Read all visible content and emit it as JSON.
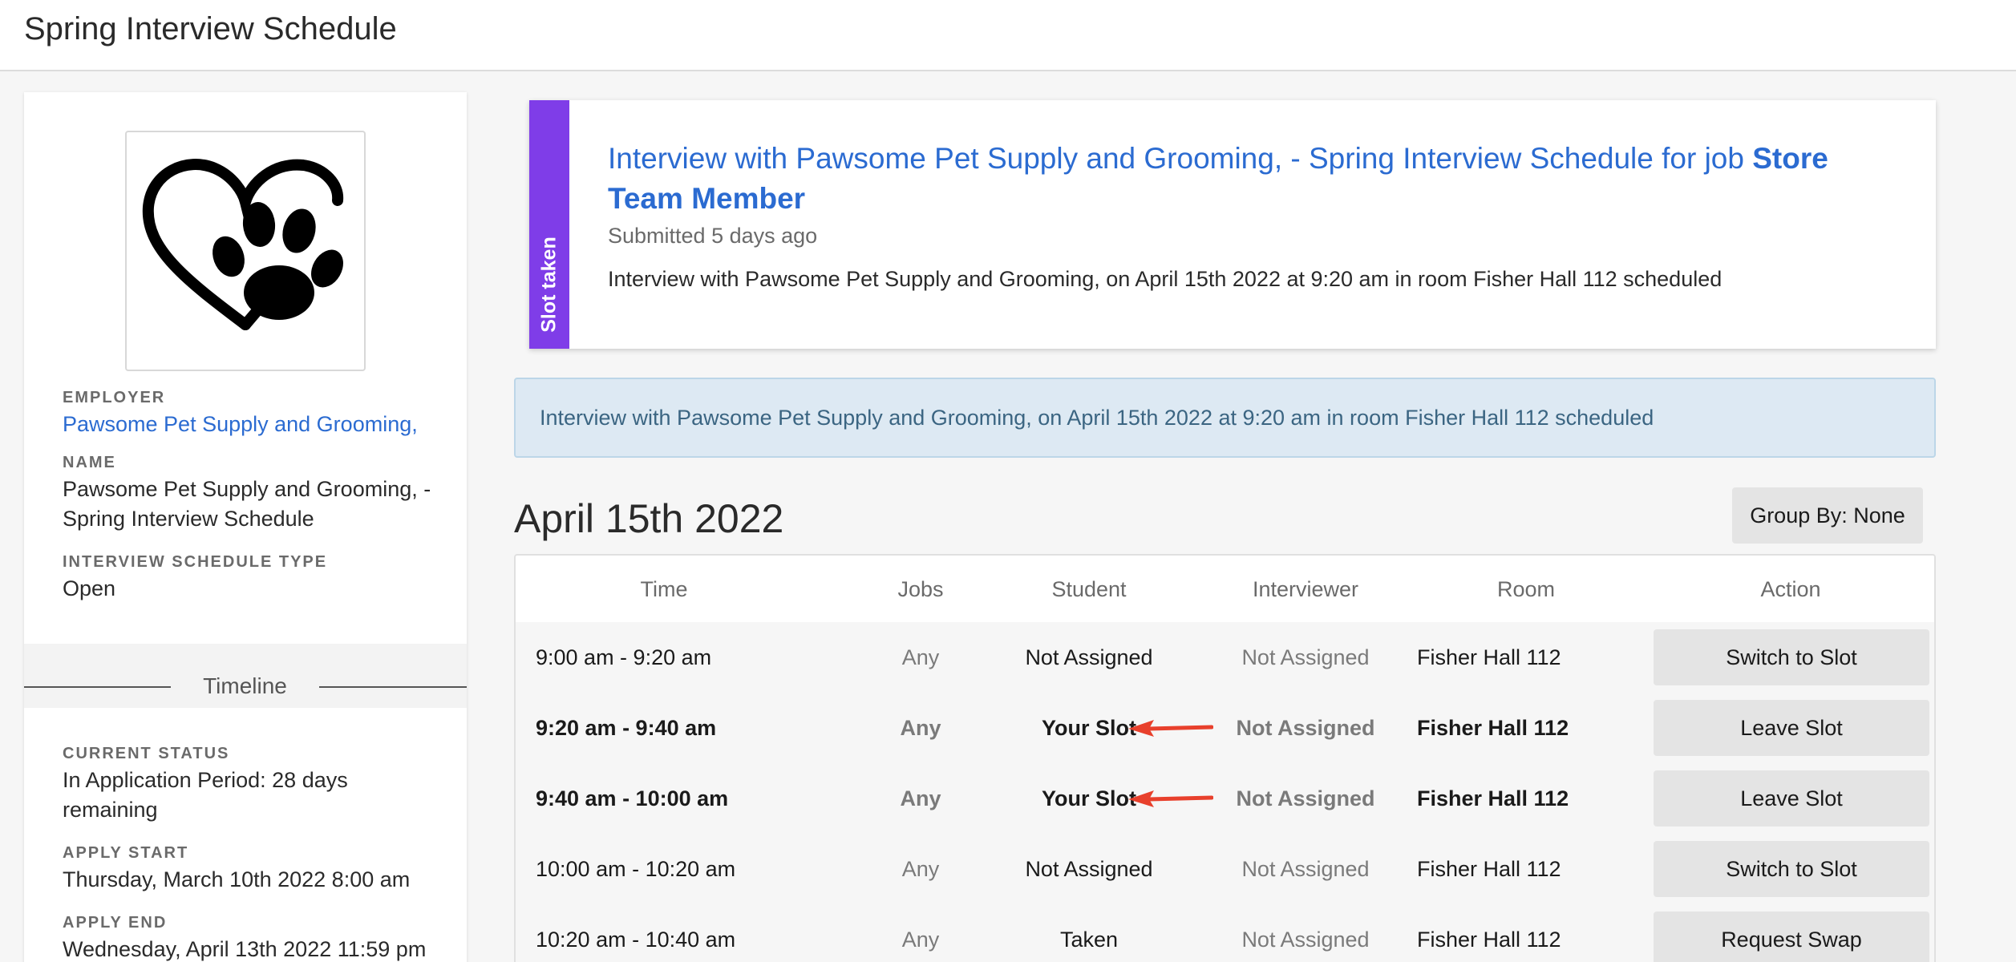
{
  "header": {
    "title": "Spring Interview Schedule"
  },
  "sidebar": {
    "logo_icon": "heart-paw-icon",
    "employer_label": "EMPLOYER",
    "employer_value": "Pawsome Pet Supply and Grooming,",
    "name_label": "NAME",
    "name_value": "Pawsome Pet Supply and Grooming, - Spring Interview Schedule",
    "type_label": "INTERVIEW SCHEDULE TYPE",
    "type_value": "Open",
    "timeline_title": "Timeline",
    "status_label": "CURRENT STATUS",
    "status_value": "In Application Period: 28 days remaining",
    "apply_start_label": "APPLY START",
    "apply_start_value": "Thursday, March 10th 2022 8:00 am",
    "apply_end_label": "APPLY END",
    "apply_end_value": "Wednesday, April 13th 2022 11:59 pm"
  },
  "notification": {
    "stripe_label": "Slot taken",
    "stripe_color": "#7f3de8",
    "title_prefix": "Interview with Pawsome Pet Supply and Grooming, - Spring Interview Schedule for job ",
    "title_job": "Store Team Member",
    "submitted": "Submitted 5 days ago",
    "body": "Interview with Pawsome Pet Supply and Grooming, on April 15th 2022 at 9:20 am in room Fisher Hall 112 scheduled"
  },
  "alert": {
    "text": "Interview with Pawsome Pet Supply and Grooming, on April 15th 2022 at 9:20 am in room Fisher Hall 112 scheduled"
  },
  "schedule": {
    "date": "April 15th 2022",
    "group_by_label": "Group By: None",
    "columns": {
      "time": "Time",
      "jobs": "Jobs",
      "student": "Student",
      "interviewer": "Interviewer",
      "room": "Room",
      "action": "Action"
    },
    "rows": [
      {
        "time": "9:00 am - 9:20 am",
        "jobs": "Any",
        "student": "Not Assigned",
        "interviewer": "Not Assigned",
        "room": "Fisher Hall 112",
        "action": "Switch to Slot"
      },
      {
        "time": "9:20 am - 9:40 am",
        "jobs": "Any",
        "student": "Your Slot",
        "interviewer": "Not Assigned",
        "room": "Fisher Hall 112",
        "action": "Leave Slot"
      },
      {
        "time": "9:40 am - 10:00 am",
        "jobs": "Any",
        "student": "Your Slot",
        "interviewer": "Not Assigned",
        "room": "Fisher Hall 112",
        "action": "Leave Slot"
      },
      {
        "time": "10:00 am - 10:20 am",
        "jobs": "Any",
        "student": "Not Assigned",
        "interviewer": "Not Assigned",
        "room": "Fisher Hall 112",
        "action": "Switch to Slot"
      },
      {
        "time": "10:20 am - 10:40 am",
        "jobs": "Any",
        "student": "Taken",
        "interviewer": "Not Assigned",
        "room": "Fisher Hall 112",
        "action": "Request Swap"
      }
    ]
  },
  "colors": {
    "link": "#2b6bd1",
    "arrow": "#e8402c",
    "alert_bg": "#dde9f3"
  }
}
